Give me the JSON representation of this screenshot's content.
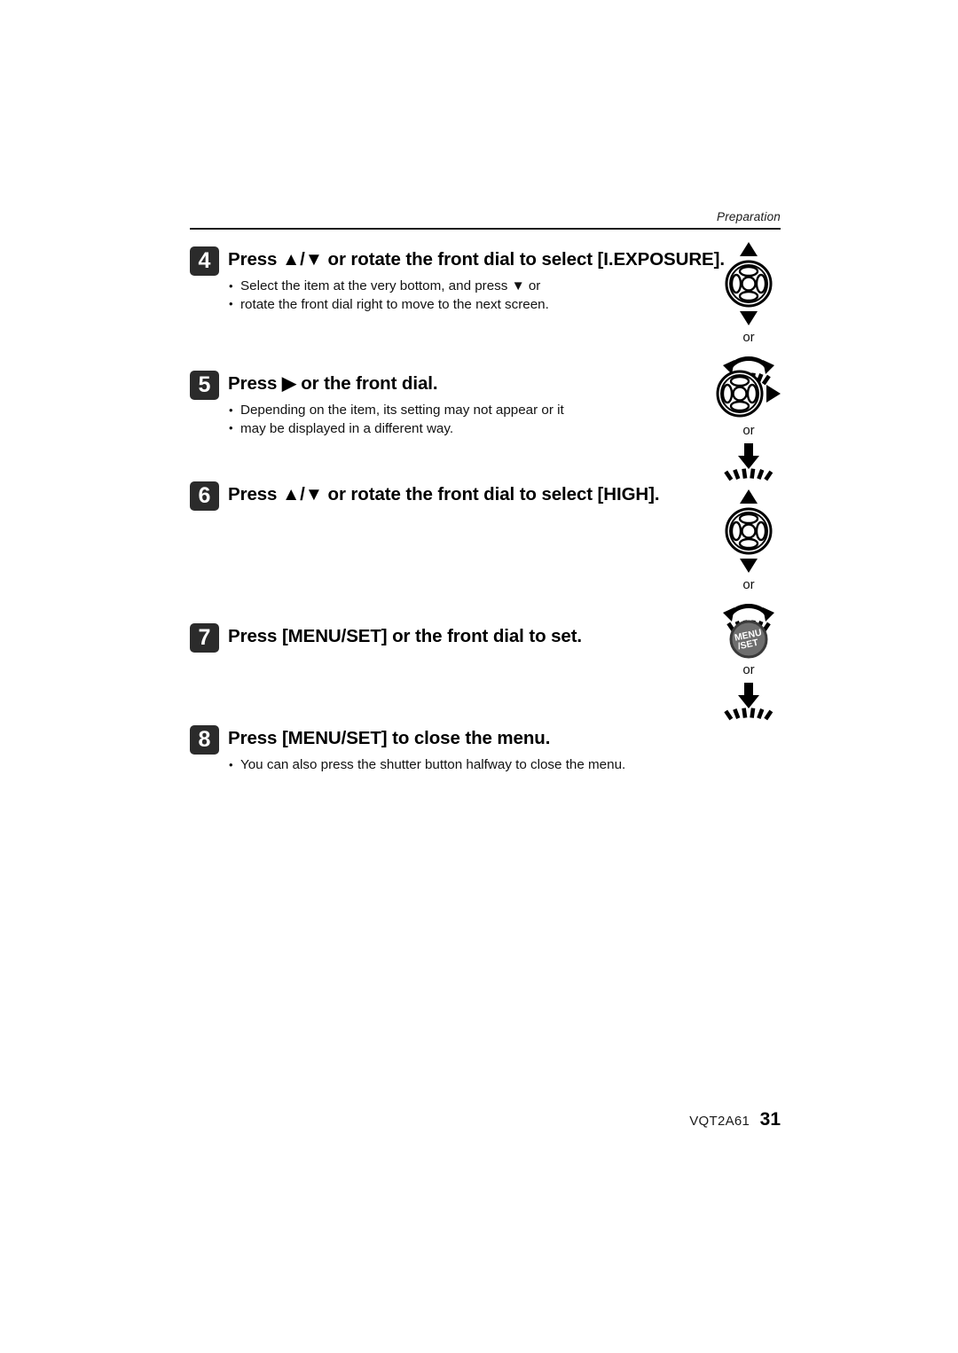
{
  "page": {
    "running_head": "Preparation",
    "footer_code": "VQT2A61",
    "footer_page": "31"
  },
  "steps": [
    {
      "number": "4",
      "title": "Press ▲/▼ or rotate the front dial to select [I.EXPOSURE].",
      "bullets": [
        "Select the item at the very bottom, and press ▼ or",
        "rotate the front dial right to move to the next screen."
      ]
    },
    {
      "number": "5",
      "title": "Press ▶ or the front dial.",
      "bullets": [
        "Depending on the item, its setting may not appear or it",
        "may be displayed in a different way."
      ]
    },
    {
      "number": "6",
      "title": "Press ▲/▼ or rotate the front dial to select [HIGH].",
      "bullets": []
    },
    {
      "number": "7",
      "title": "Press [MENU/SET] or the front dial to set.",
      "bullets": []
    },
    {
      "number": "8",
      "title": "Press [MENU/SET] to close the menu.",
      "bullets": [
        "You can also press the shutter button halfway to close the menu."
      ]
    }
  ],
  "icon_groups": [
    {
      "for_step": "4",
      "primary_icon": "cursor-pad-up-down-icon",
      "connector": "or",
      "secondary_icon": "rotate-front-dial-icon"
    },
    {
      "for_step": "5",
      "primary_icon": "cursor-pad-right-icon",
      "connector": "or",
      "secondary_icon": "press-front-dial-icon"
    },
    {
      "for_step": "6",
      "primary_icon": "cursor-pad-up-down-icon",
      "connector": "or",
      "secondary_icon": "rotate-front-dial-icon"
    },
    {
      "for_step": "7",
      "primary_icon": "menu-set-button-icon",
      "connector": "or",
      "secondary_icon": "press-front-dial-icon"
    }
  ],
  "icon_labels": {
    "menu_line1": "MENU",
    "menu_line2": "/SET"
  },
  "colors": {
    "badge_bg": "#2b2b2b",
    "menu_button_fill": "#6e6e6e",
    "menu_button_stroke": "#3a3a3a",
    "rule": "#1c1c1c",
    "text": "#000000"
  }
}
